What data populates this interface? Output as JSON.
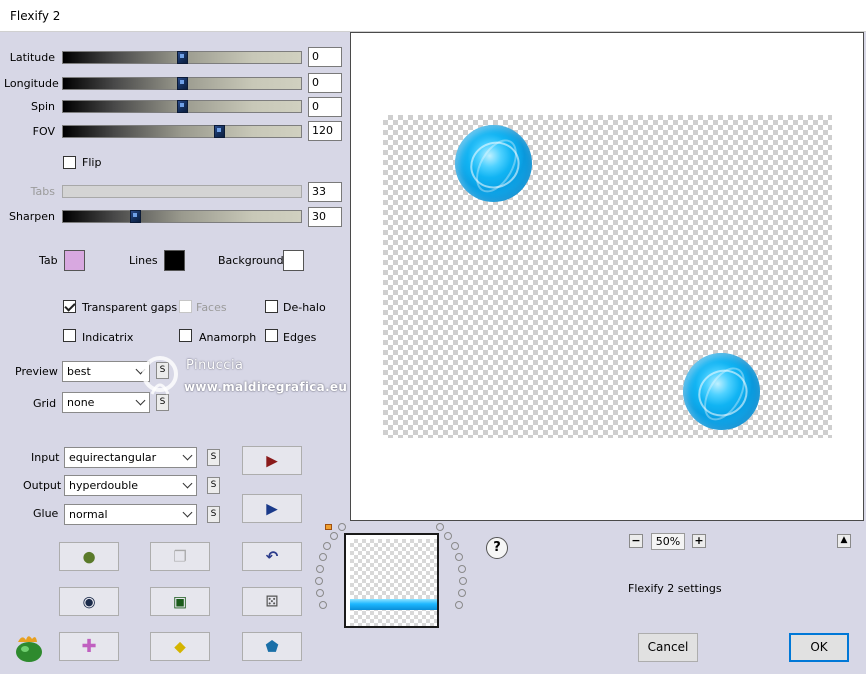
{
  "window": {
    "title": "Flexify 2"
  },
  "sliders": [
    {
      "label": "Latitude",
      "value": "0",
      "level": 0.5,
      "enabled": true
    },
    {
      "label": "Longitude",
      "value": "0",
      "level": 0.5,
      "enabled": true
    },
    {
      "label": "Spin",
      "value": "0",
      "level": 0.5,
      "enabled": true
    },
    {
      "label": "FOV",
      "value": "120",
      "level": 0.66,
      "enabled": true
    },
    {
      "label": "Tabs",
      "value": "33",
      "level": 0.33,
      "enabled": false
    },
    {
      "label": "Sharpen",
      "value": "30",
      "level": 0.3,
      "enabled": true
    }
  ],
  "flip": {
    "label": "Flip",
    "checked": false
  },
  "colors": {
    "tab": {
      "label": "Tab",
      "color": "#d8a8e0"
    },
    "lines": {
      "label": "Lines",
      "color": "#000000"
    },
    "background": {
      "label": "Background",
      "color": "#ffffff"
    }
  },
  "options": {
    "transparent_gaps": {
      "label": "Transparent gaps",
      "checked": true,
      "enabled": true
    },
    "faces": {
      "label": "Faces",
      "checked": false,
      "enabled": false
    },
    "de_halo": {
      "label": "De-halo",
      "checked": false,
      "enabled": true
    },
    "indicatrix": {
      "label": "Indicatrix",
      "checked": false,
      "enabled": true
    },
    "anamorph": {
      "label": "Anamorph",
      "checked": false,
      "enabled": true
    },
    "edges": {
      "label": "Edges",
      "checked": false,
      "enabled": true
    }
  },
  "preview": {
    "label": "Preview",
    "value": "best"
  },
  "grid": {
    "label": "Grid",
    "value": "none"
  },
  "input": {
    "label": "Input",
    "value": "equirectangular"
  },
  "output": {
    "label": "Output",
    "value": "hyperdouble"
  },
  "glue": {
    "label": "Glue",
    "value": "normal"
  },
  "s_label": "S",
  "watermark": {
    "name": "Pinuccia",
    "site": "www.maldiregrafica.eu"
  },
  "zoom": {
    "value": "50%",
    "minus": "−",
    "plus": "+"
  },
  "help": "?",
  "settings_name": "Flexify 2 settings",
  "dialog": {
    "cancel": "Cancel",
    "ok": "OK"
  },
  "accent_color": "#0078d7",
  "globe_color": "#11b4f3"
}
